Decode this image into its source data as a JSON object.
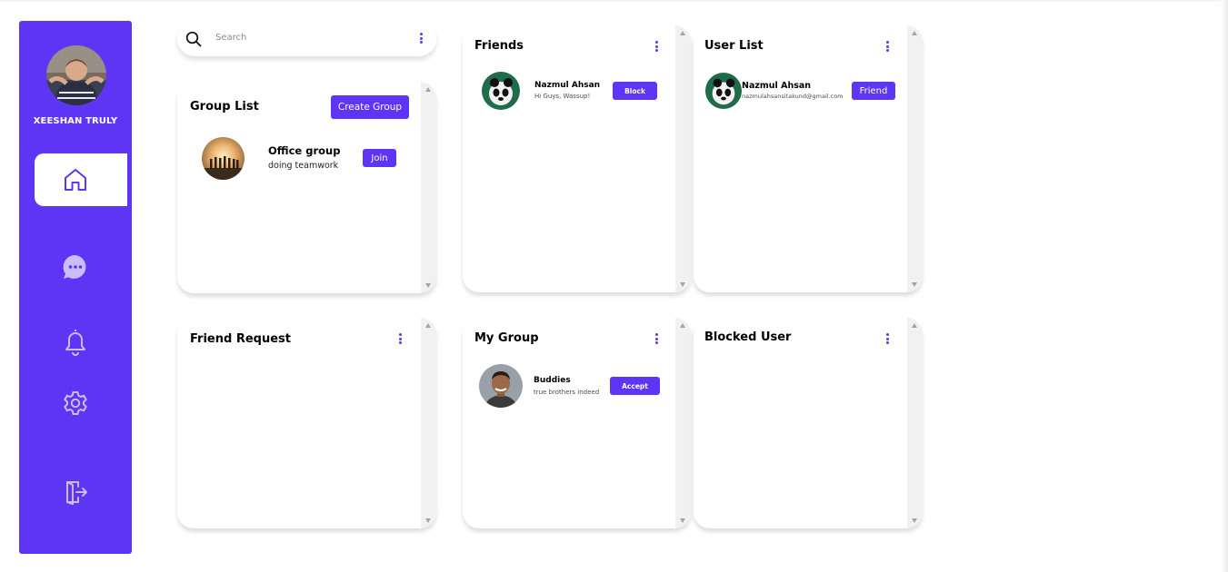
{
  "user": {
    "name": "XEESHAN TRULY"
  },
  "search": {
    "placeholder": "Search"
  },
  "group_list": {
    "title": "Group List",
    "create_label": "Create Group",
    "items": [
      {
        "name": "Office group",
        "subtitle": "doing teamwork",
        "action": "Join"
      }
    ]
  },
  "friends": {
    "title": "Friends",
    "items": [
      {
        "name": "Nazmul Ahsan",
        "subtitle": "Hi Guys, Wassup!",
        "action": "Block"
      }
    ]
  },
  "user_list": {
    "title": "User List",
    "items": [
      {
        "name": "Nazmul Ahsan",
        "subtitle": "nazmulahsansitakund@gmail.com",
        "action": "Friend"
      }
    ]
  },
  "friend_request": {
    "title": "Friend Request"
  },
  "my_group": {
    "title": "My Group",
    "items": [
      {
        "name": "Buddies",
        "subtitle": "true brothers indeed",
        "action": "Accept"
      }
    ]
  },
  "blocked_user": {
    "title": "Blocked User"
  },
  "icons": [
    "home-icon",
    "chat-icon",
    "bell-icon",
    "settings-icon",
    "logout-icon",
    "search-icon",
    "more-vertical-icon"
  ],
  "colors": {
    "accent": "#5f35f5",
    "accent_light": "#c9bdfc"
  }
}
